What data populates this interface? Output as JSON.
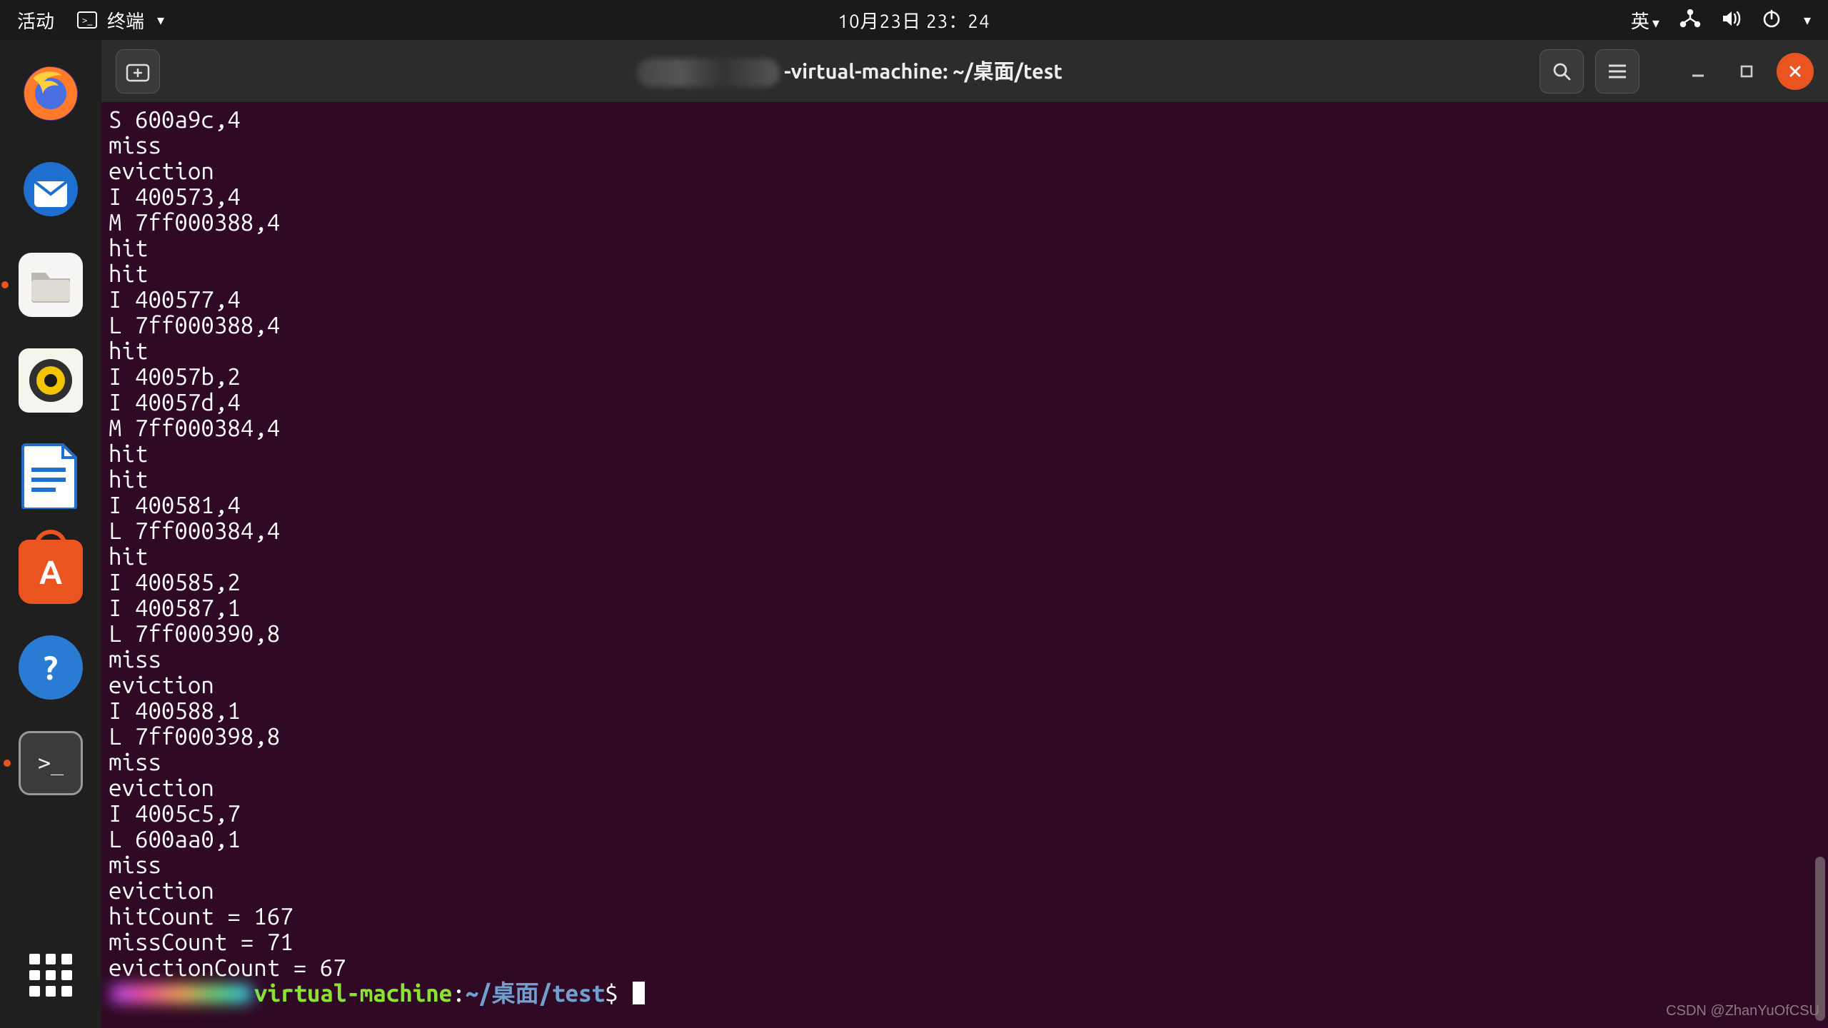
{
  "topbar": {
    "activities": "活动",
    "app_name": "终端",
    "date_time": "10月23日 23：24",
    "input_method": "英"
  },
  "dock": {
    "firefox": "firefox",
    "thunderbird": "thunderbird",
    "files": "files",
    "rhythmbox": "rhythmbox",
    "writer": "libreoffice-writer",
    "software": "ubuntu-software",
    "help": "help",
    "terminal": "terminal",
    "show_apps": "show-applications"
  },
  "window": {
    "title_suffix": "-virtual-machine: ~/桌面/test",
    "new_tab_tooltip": "New Tab",
    "search_tooltip": "Search",
    "menu_tooltip": "Menu",
    "minimize_tooltip": "Minimize",
    "maximize_tooltip": "Maximize",
    "close_tooltip": "Close"
  },
  "terminal": {
    "lines": [
      "S 600a9c,4",
      "miss",
      "eviction",
      "I 400573,4",
      "M 7ff000388,4",
      "hit",
      "hit",
      "I 400577,4",
      "L 7ff000388,4",
      "hit",
      "I 40057b,2",
      "I 40057d,4",
      "M 7ff000384,4",
      "hit",
      "hit",
      "I 400581,4",
      "L 7ff000384,4",
      "hit",
      "I 400585,2",
      "I 400587,1",
      "L 7ff000390,8",
      "miss",
      "eviction",
      "I 400588,1",
      "L 7ff000398,8",
      "miss",
      "eviction",
      "I 4005c5,7",
      "L 600aa0,1",
      "miss",
      "eviction",
      "hitCount = 167",
      "missCount = 71",
      "evictionCount = 67"
    ],
    "prompt_host": "virtual-machine",
    "prompt_colon": ":",
    "prompt_path": "~/桌面/test",
    "prompt_dollar": "$"
  },
  "watermark": "CSDN @ZhanYuOfCSU"
}
